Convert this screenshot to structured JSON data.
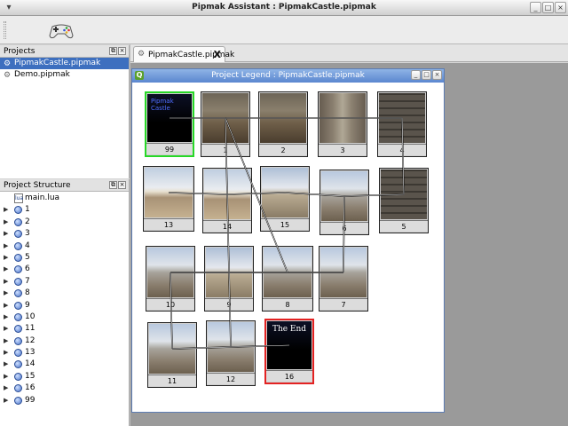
{
  "window": {
    "title": "Pipmak Assistant : PipmakCastle.pipmak",
    "buttons": {
      "minimize": "_",
      "maximize": "□",
      "close": "×"
    }
  },
  "toolbar": {
    "run_icon": "gamepad-icon"
  },
  "projects_panel": {
    "title": "Projects",
    "items": [
      {
        "label": "PipmakCastle.pipmak",
        "selected": true
      },
      {
        "label": "Demo.pipmak",
        "selected": false
      }
    ]
  },
  "structure_panel": {
    "title": "Project Structure",
    "items": [
      "main.lua",
      "1",
      "2",
      "3",
      "4",
      "5",
      "6",
      "7",
      "8",
      "9",
      "10",
      "11",
      "12",
      "13",
      "14",
      "15",
      "16",
      "99"
    ]
  },
  "tabs": [
    {
      "label": "PipmakCastle.pipmak",
      "close": "X"
    }
  ],
  "legend_window": {
    "title": "Project Legend : PipmakCastle.pipmak",
    "app_icon": "Q",
    "buttons": {
      "minimize": "_",
      "maximize": "□",
      "close": "×"
    },
    "start_caption": "Pipmak Castle",
    "end_caption": "The End",
    "nodes": [
      {
        "id": "99",
        "style": "dark",
        "role": "start"
      },
      {
        "id": "1",
        "style": "stone-room"
      },
      {
        "id": "2",
        "style": "stone-room"
      },
      {
        "id": "3",
        "style": "wallgap"
      },
      {
        "id": "4",
        "style": "wall"
      },
      {
        "id": "13",
        "style": "fence"
      },
      {
        "id": "14",
        "style": "fence"
      },
      {
        "id": "15",
        "style": "sky"
      },
      {
        "id": "6",
        "style": "walkway"
      },
      {
        "id": "5",
        "style": "wall"
      },
      {
        "id": "10",
        "style": "walkway"
      },
      {
        "id": "9",
        "style": "sky"
      },
      {
        "id": "8",
        "style": "walkway"
      },
      {
        "id": "7",
        "style": "walkway"
      },
      {
        "id": "11",
        "style": "walkway"
      },
      {
        "id": "12",
        "style": "walkway"
      },
      {
        "id": "16",
        "style": "dark",
        "role": "end"
      }
    ]
  }
}
